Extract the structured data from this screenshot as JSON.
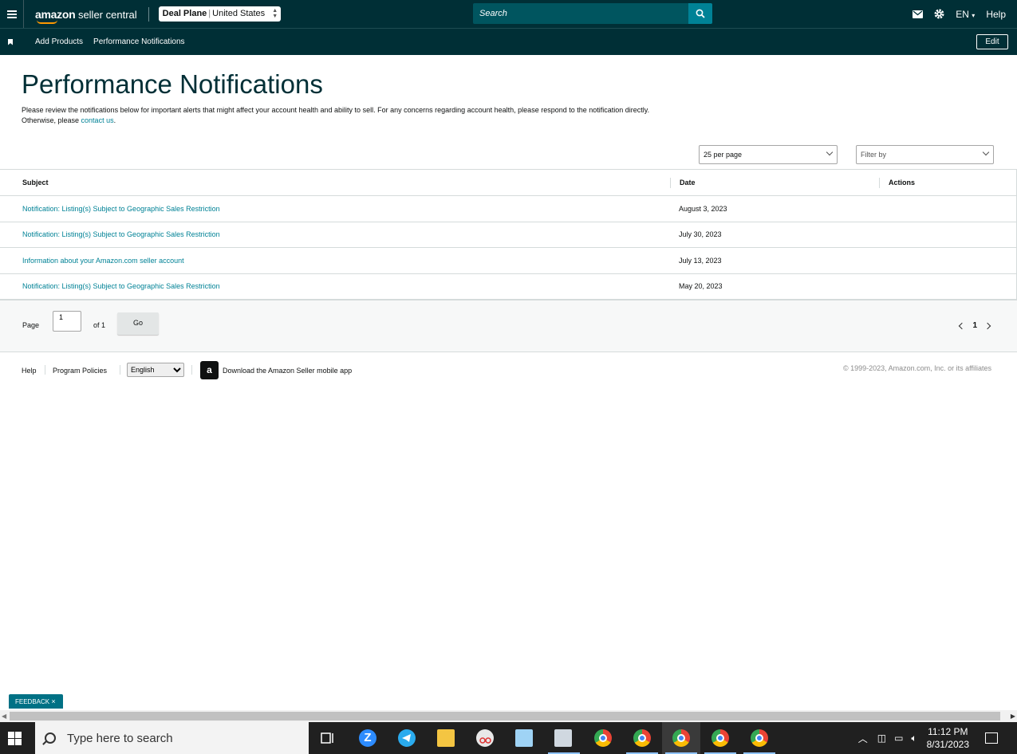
{
  "header": {
    "logo_text_bold": "amazon",
    "logo_text": " seller central",
    "account_name": "Deal Plane",
    "account_region": "United States",
    "search_placeholder": "Search",
    "language": "EN",
    "help": "Help"
  },
  "subnav": {
    "items": [
      {
        "label": "Add Products"
      },
      {
        "label": "Performance Notifications"
      }
    ],
    "edit_label": "Edit"
  },
  "page": {
    "title": "Performance Notifications",
    "intro_text": "Please review the notifications below for important alerts that might affect your account health and ability to sell. For any concerns regarding account health, please respond to the notification directly. Otherwise, please ",
    "intro_link": "contact us",
    "intro_end": "."
  },
  "controls": {
    "per_page": "25 per page",
    "filter_placeholder": "Filter by"
  },
  "table": {
    "headers": {
      "subject": "Subject",
      "date": "Date",
      "actions": "Actions"
    },
    "rows": [
      {
        "subject": "Notification: Listing(s) Subject to Geographic Sales Restriction",
        "date": "August 3, 2023"
      },
      {
        "subject": "Notification: Listing(s) Subject to Geographic Sales Restriction",
        "date": "July 30, 2023"
      },
      {
        "subject": "Information about your Amazon.com seller account",
        "date": "July 13, 2023"
      },
      {
        "subject": "Notification: Listing(s) Subject to Geographic Sales Restriction",
        "date": "May 20, 2023"
      }
    ]
  },
  "pagination": {
    "page_label": "Page",
    "page_value": "1",
    "of_label": "of 1",
    "go_label": "Go",
    "current": "1"
  },
  "footer": {
    "help": "Help",
    "program_policies": "Program Policies",
    "language": "English",
    "download_app": "Download the Amazon Seller mobile app",
    "copyright": "© 1999-2023, Amazon.com, Inc. or its affiliates"
  },
  "feedback": {
    "label": "FEEDBACK"
  },
  "taskbar": {
    "search_placeholder": "Type here to search",
    "time": "11:12 PM",
    "date": "8/31/2023"
  },
  "colors": {
    "header_bg": "#002f36",
    "link": "#008296",
    "accent": "#ff9900"
  }
}
